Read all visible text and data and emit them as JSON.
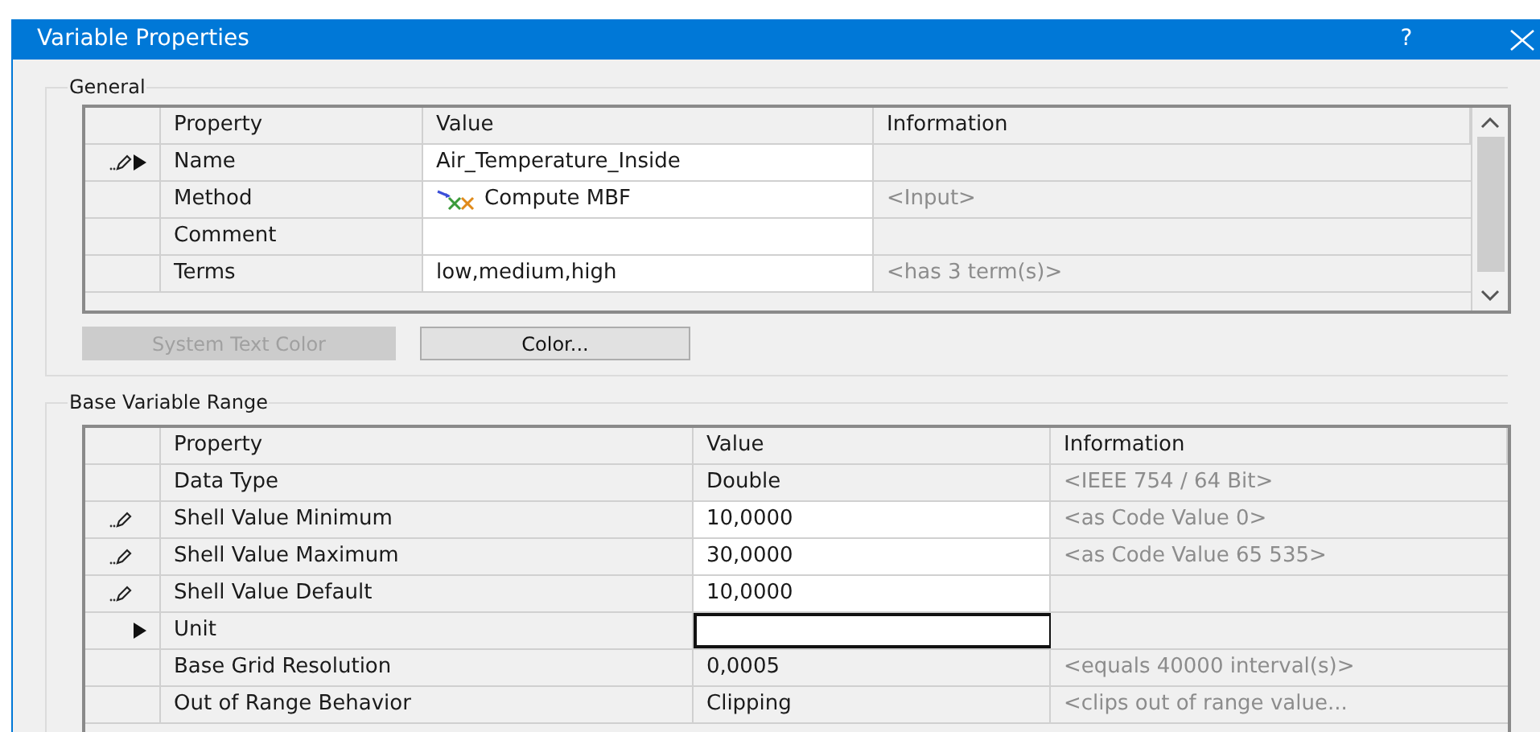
{
  "window": {
    "title": "Variable Properties",
    "help": "?"
  },
  "general": {
    "title": "General",
    "columns": [
      "Property",
      "Value",
      "Information"
    ],
    "rows": [
      {
        "editing": true,
        "current": true,
        "property": "Name",
        "value": "Air_Temperature_Inside",
        "editable": true,
        "focused": false,
        "info": ""
      },
      {
        "editing": false,
        "current": false,
        "property": "Method",
        "value": "Compute MBF",
        "value_icon": true,
        "editable": true,
        "focused": false,
        "info": "<Input>"
      },
      {
        "editing": false,
        "current": false,
        "property": "Comment",
        "value": "",
        "editable": true,
        "focused": false,
        "info": ""
      },
      {
        "editing": false,
        "current": false,
        "property": "Terms",
        "value": "low,medium,high",
        "editable": true,
        "focused": false,
        "info": "<has 3 term(s)>"
      }
    ],
    "buttons": [
      {
        "label": "System Text Color",
        "disabled": true
      },
      {
        "label": "Color...",
        "disabled": false
      }
    ]
  },
  "base_range": {
    "title": "Base Variable Range",
    "columns": [
      "Property",
      "Value",
      "Information"
    ],
    "rows": [
      {
        "editing": false,
        "current": false,
        "property": "Data Type",
        "value": "Double",
        "editable": false,
        "focused": false,
        "info": "<IEEE 754 / 64 Bit>"
      },
      {
        "editing": true,
        "current": false,
        "property": "Shell Value Minimum",
        "value": "10,0000",
        "editable": true,
        "focused": false,
        "info": "<as Code Value 0>"
      },
      {
        "editing": true,
        "current": false,
        "property": "Shell Value Maximum",
        "value": "30,0000",
        "editable": true,
        "focused": false,
        "info": "<as Code Value 65 535>"
      },
      {
        "editing": true,
        "current": false,
        "property": "Shell Value Default",
        "value": "10,0000",
        "editable": true,
        "focused": false,
        "info": ""
      },
      {
        "editing": false,
        "current": true,
        "property": "Unit",
        "value": "",
        "editable": true,
        "focused": true,
        "info": ""
      },
      {
        "editing": false,
        "current": false,
        "property": "Base Grid Resolution",
        "value": "0,0005",
        "editable": false,
        "focused": false,
        "info": "<equals 40000 interval(s)>"
      },
      {
        "editing": false,
        "current": false,
        "property": "Out of Range Behavior",
        "value": "Clipping",
        "editable": false,
        "focused": false,
        "info": "<clips out of range value..."
      }
    ]
  }
}
